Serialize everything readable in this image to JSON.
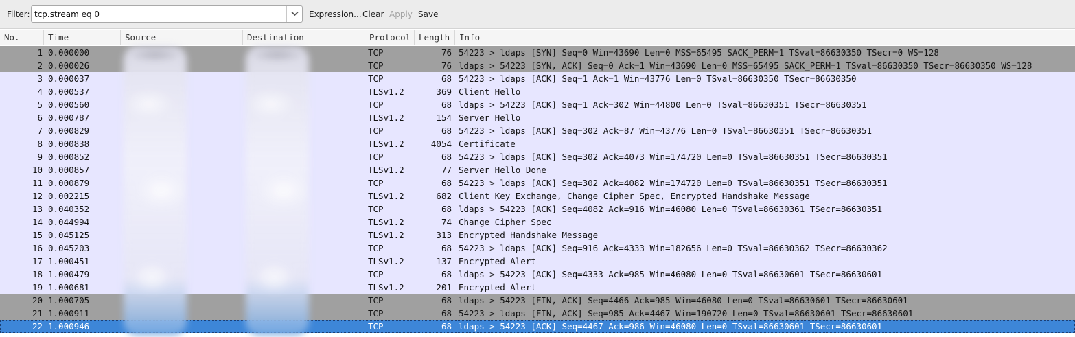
{
  "filterbar": {
    "label": "Filter:",
    "value": "tcp.stream eq 0",
    "placeholder": "",
    "dropdown_icon": "chevron-down-icon",
    "expression_label": "Expression...",
    "clear_label": "Clear",
    "apply_label": "Apply",
    "save_label": "Save"
  },
  "columns": {
    "no": "No.",
    "time": "Time",
    "source": "Source",
    "destination": "Destination",
    "protocol": "Protocol",
    "length": "Length",
    "info": "Info"
  },
  "colors": {
    "row_normal": "#e7e6ff",
    "row_rst_fin_syn": "#a0a0a0",
    "row_selected": "#3d86d8"
  },
  "packets": [
    {
      "no": "1",
      "time": "0.000000",
      "protocol": "TCP",
      "length": "76",
      "info": "54223 > ldaps [SYN] Seq=0 Win=43690 Len=0 MSS=65495 SACK_PERM=1 TSval=86630350 TSecr=0 WS=128",
      "style": "rst"
    },
    {
      "no": "2",
      "time": "0.000026",
      "protocol": "TCP",
      "length": "76",
      "info": "ldaps > 54223 [SYN, ACK] Seq=0 Ack=1 Win=43690 Len=0 MSS=65495 SACK_PERM=1 TSval=86630350 TSecr=86630350 WS=128",
      "style": "rst"
    },
    {
      "no": "3",
      "time": "0.000037",
      "protocol": "TCP",
      "length": "68",
      "info": "54223 > ldaps [ACK] Seq=1 Ack=1 Win=43776 Len=0 TSval=86630350 TSecr=86630350",
      "style": "norm"
    },
    {
      "no": "4",
      "time": "0.000537",
      "protocol": "TLSv1.2",
      "length": "369",
      "info": "Client Hello",
      "style": "norm"
    },
    {
      "no": "5",
      "time": "0.000560",
      "protocol": "TCP",
      "length": "68",
      "info": "ldaps > 54223 [ACK] Seq=1 Ack=302 Win=44800 Len=0 TSval=86630351 TSecr=86630351",
      "style": "norm"
    },
    {
      "no": "6",
      "time": "0.000787",
      "protocol": "TLSv1.2",
      "length": "154",
      "info": "Server Hello",
      "style": "norm"
    },
    {
      "no": "7",
      "time": "0.000829",
      "protocol": "TCP",
      "length": "68",
      "info": "54223 > ldaps [ACK] Seq=302 Ack=87 Win=43776 Len=0 TSval=86630351 TSecr=86630351",
      "style": "norm"
    },
    {
      "no": "8",
      "time": "0.000838",
      "protocol": "TLSv1.2",
      "length": "4054",
      "info": "Certificate",
      "style": "norm"
    },
    {
      "no": "9",
      "time": "0.000852",
      "protocol": "TCP",
      "length": "68",
      "info": "54223 > ldaps [ACK] Seq=302 Ack=4073 Win=174720 Len=0 TSval=86630351 TSecr=86630351",
      "style": "norm"
    },
    {
      "no": "10",
      "time": "0.000857",
      "protocol": "TLSv1.2",
      "length": "77",
      "info": "Server Hello Done",
      "style": "norm"
    },
    {
      "no": "11",
      "time": "0.000879",
      "protocol": "TCP",
      "length": "68",
      "info": "54223 > ldaps [ACK] Seq=302 Ack=4082 Win=174720 Len=0 TSval=86630351 TSecr=86630351",
      "style": "norm"
    },
    {
      "no": "12",
      "time": "0.002215",
      "protocol": "TLSv1.2",
      "length": "682",
      "info": "Client Key Exchange, Change Cipher Spec, Encrypted Handshake Message",
      "style": "norm"
    },
    {
      "no": "13",
      "time": "0.040352",
      "protocol": "TCP",
      "length": "68",
      "info": "ldaps > 54223 [ACK] Seq=4082 Ack=916 Win=46080 Len=0 TSval=86630361 TSecr=86630351",
      "style": "norm"
    },
    {
      "no": "14",
      "time": "0.044994",
      "protocol": "TLSv1.2",
      "length": "74",
      "info": "Change Cipher Spec",
      "style": "norm"
    },
    {
      "no": "15",
      "time": "0.045125",
      "protocol": "TLSv1.2",
      "length": "313",
      "info": "Encrypted Handshake Message",
      "style": "norm"
    },
    {
      "no": "16",
      "time": "0.045203",
      "protocol": "TCP",
      "length": "68",
      "info": "54223 > ldaps [ACK] Seq=916 Ack=4333 Win=182656 Len=0 TSval=86630362 TSecr=86630362",
      "style": "norm"
    },
    {
      "no": "17",
      "time": "1.000451",
      "protocol": "TLSv1.2",
      "length": "137",
      "info": "Encrypted Alert",
      "style": "norm"
    },
    {
      "no": "18",
      "time": "1.000479",
      "protocol": "TCP",
      "length": "68",
      "info": "ldaps > 54223 [ACK] Seq=4333 Ack=985 Win=46080 Len=0 TSval=86630601 TSecr=86630601",
      "style": "norm"
    },
    {
      "no": "19",
      "time": "1.000681",
      "protocol": "TLSv1.2",
      "length": "201",
      "info": "Encrypted Alert",
      "style": "norm"
    },
    {
      "no": "20",
      "time": "1.000705",
      "protocol": "TCP",
      "length": "68",
      "info": "ldaps > 54223 [FIN, ACK] Seq=4466 Ack=985 Win=46080 Len=0 TSval=86630601 TSecr=86630601",
      "style": "rst"
    },
    {
      "no": "21",
      "time": "1.000911",
      "protocol": "TCP",
      "length": "68",
      "info": "54223 > ldaps [FIN, ACK] Seq=985 Ack=4467 Win=190720 Len=0 TSval=86630601 TSecr=86630601",
      "style": "rst"
    },
    {
      "no": "22",
      "time": "1.000946",
      "protocol": "TCP",
      "length": "68",
      "info": "ldaps > 54223 [ACK] Seq=4467 Ack=986 Win=46080 Len=0 TSval=86630601 TSecr=86630601",
      "style": "sel"
    }
  ]
}
